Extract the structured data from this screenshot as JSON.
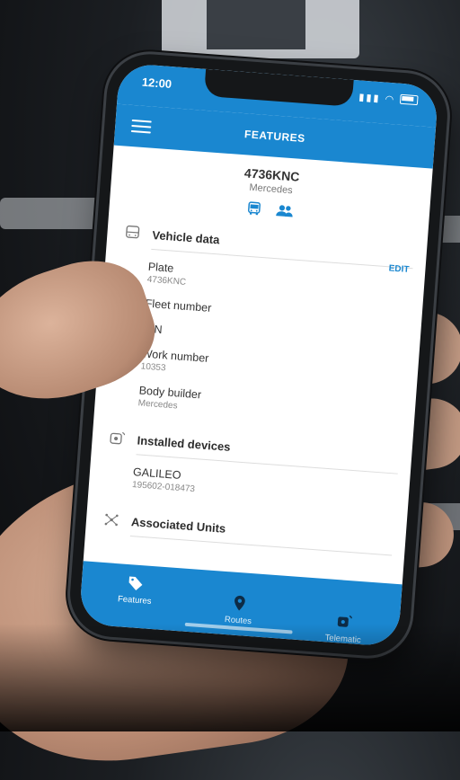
{
  "status_bar": {
    "time": "12:00"
  },
  "app_bar": {
    "title": "FEATURES"
  },
  "vehicle": {
    "plate": "4736KNC",
    "brand": "Mercedes"
  },
  "sections": {
    "vehicle_data": {
      "title": "Vehicle data",
      "edit_label": "EDIT",
      "fields": [
        {
          "label": "Plate",
          "value": "4736KNC"
        },
        {
          "label": "Fleet number",
          "value": ""
        },
        {
          "label": "VIN",
          "value": ""
        },
        {
          "label": "Work number",
          "value": "10353"
        },
        {
          "label": "Body builder",
          "value": "Mercedes"
        }
      ]
    },
    "installed_devices": {
      "title": "Installed devices",
      "items": [
        {
          "label": "GALILEO",
          "value": "195602-018473"
        }
      ]
    },
    "associated_units": {
      "title": "Associated Units"
    }
  },
  "tabs": [
    {
      "label": "Features",
      "icon": "tag-icon"
    },
    {
      "label": "Routes",
      "icon": "location-pin-icon"
    },
    {
      "label": "Telematic",
      "icon": "telematic-device-icon"
    }
  ],
  "colors": {
    "primary": "#1a87d0",
    "accent_text": "#1a87d0"
  }
}
